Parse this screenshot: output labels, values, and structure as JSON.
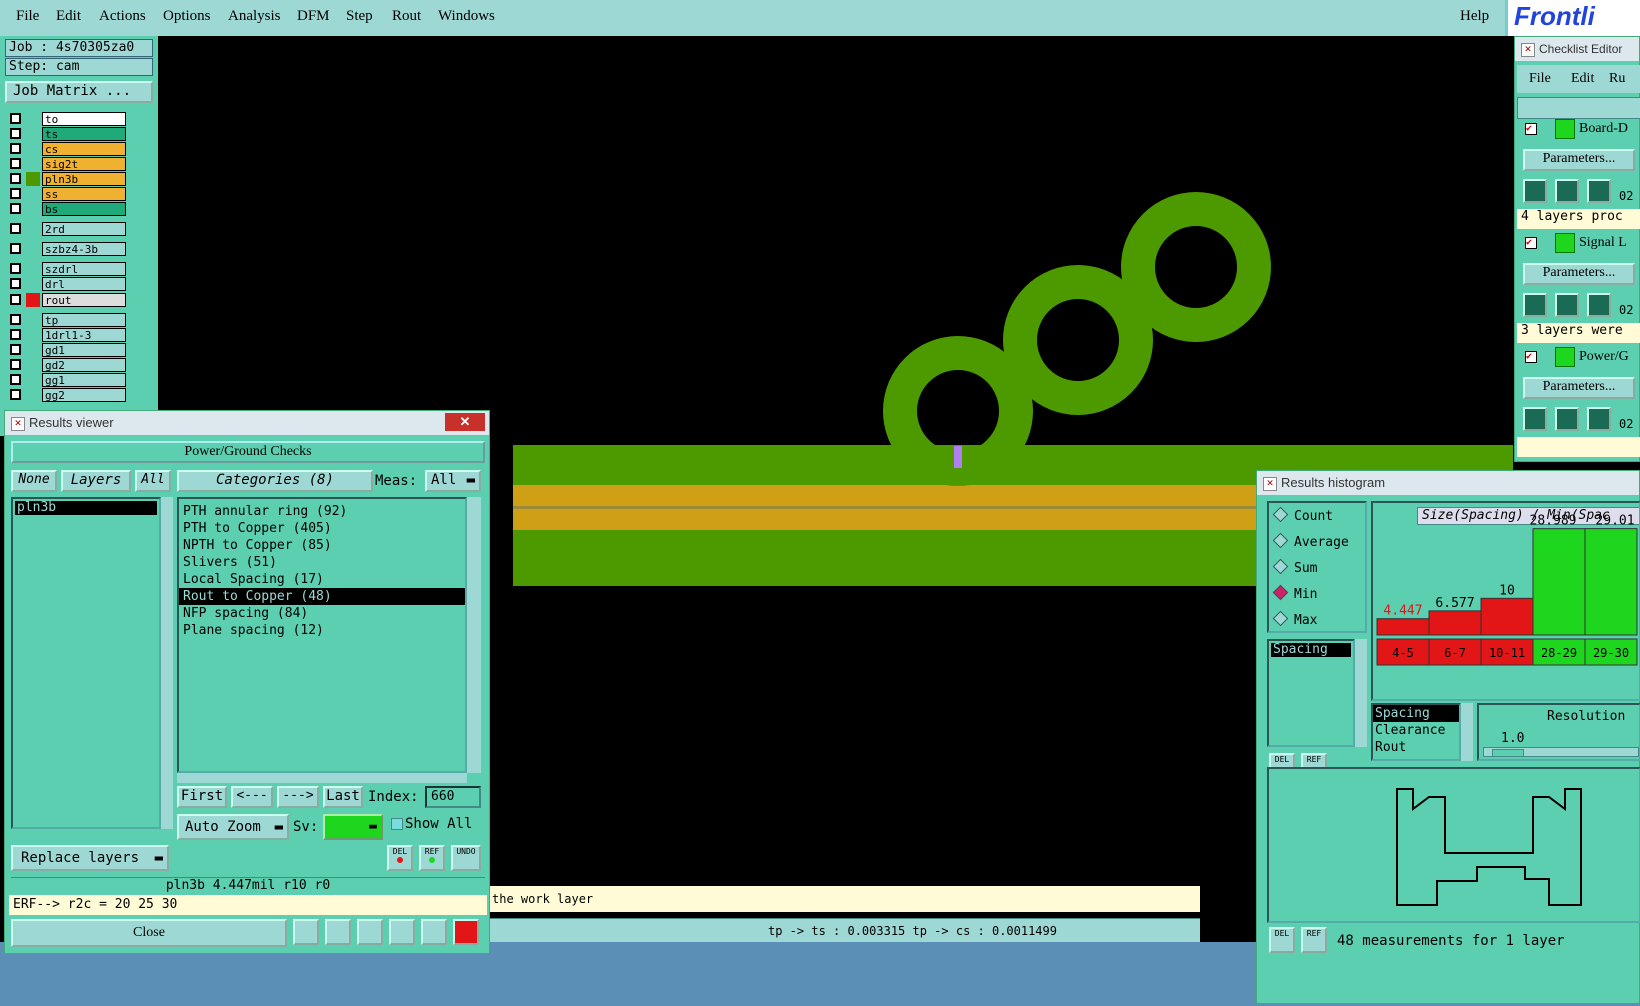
{
  "menu": [
    "File",
    "Edit",
    "Actions",
    "Options",
    "Analysis",
    "DFM",
    "Step",
    "Rout",
    "Windows"
  ],
  "help": "Help",
  "logo": "Frontli",
  "job": {
    "job_line": "Job : 4s70305za0",
    "step_line": "Step: cam",
    "matrix_button": "Job Matrix ..."
  },
  "layers": [
    "to",
    "ts",
    "cs",
    "sig2t",
    "pln3b",
    "ss",
    "bs",
    "2rd",
    "szbz4-3b",
    "szdrl",
    "drl",
    "rout",
    "tp",
    "1drl1-3",
    "gd1",
    "gd2",
    "gg1",
    "gg2"
  ],
  "colors": {
    "copper_green": "#4d9a00",
    "drill_orange": "#cfa015",
    "panel_teal": "#5ccfb0",
    "hist_red": "#e21616",
    "hist_green": "#1fd61f"
  },
  "results_viewer": {
    "title": "Results viewer",
    "group": "Power/Ground Checks",
    "none": "None",
    "layers": "Layers",
    "all": "All",
    "categories_header": "Categories (8)",
    "meas_label": "Meas:",
    "meas_value": "All",
    "layer_list": [
      "pln3b"
    ],
    "categories": [
      "PTH annular ring (92)",
      "PTH to Copper (405)",
      "NPTH to Copper (85)",
      "Slivers (51)",
      "Local Spacing (17)",
      "Rout to Copper (48)",
      "NFP spacing (84)",
      "Plane spacing (12)"
    ],
    "first": "First",
    "prev": "<---",
    "next": "--->",
    "last": "Last",
    "index_label": "Index:",
    "index_value": "660",
    "auto_zoom": "Auto Zoom",
    "sv_label": "Sv:",
    "show_all": "Show All",
    "replace_layers": "Replace layers",
    "del": "DEL",
    "ref": "REF",
    "undo": "UNDO",
    "status": "pln3b 4.447mil  r10  r0",
    "erf": "ERF--> r2c = 20 25 30",
    "close": "Close"
  },
  "status_bar": {
    "message": "the work layer",
    "measure": "tp -> ts : 0.003315    tp -> cs : 0.0011499"
  },
  "checklist": {
    "title": "Checklist Editor",
    "menu": [
      "File",
      "Edit",
      "Ru"
    ],
    "items": [
      {
        "name": "Board-D",
        "params": "Parameters...",
        "note": "4 layers proc",
        "num": "02"
      },
      {
        "name": "Signal L",
        "params": "Parameters...",
        "note": "3 layers were",
        "num": "02"
      },
      {
        "name": "Power/G",
        "params": "Parameters...",
        "note": "",
        "num": "02"
      }
    ]
  },
  "histogram": {
    "title": "Results histogram",
    "modes": [
      "Count",
      "Average",
      "Sum",
      "Min",
      "Max"
    ],
    "selected_mode": "Min",
    "header": "Size(Spacing) / Min(Spac",
    "left_list": [
      "Spacing"
    ],
    "bottom_list": [
      "Spacing",
      "Clearance",
      "Rout"
    ],
    "resolution_label": "Resolution",
    "resolution_value": "1.0",
    "footer": "48 measurements for 1 layer",
    "del": "DEL",
    "ref": "REF"
  },
  "chart_data": {
    "type": "bar",
    "categories": [
      "4-5",
      "6-7",
      "10-11",
      "28-29",
      "29-30"
    ],
    "values": [
      4.447,
      6.577,
      10,
      28.989,
      29.01
    ],
    "value_labels": [
      "4.447",
      "6.577",
      "10",
      "28.989",
      "29.01"
    ],
    "bar_colors": [
      "red",
      "red",
      "red",
      "green",
      "green"
    ],
    "title": "Size(Spacing) / Min(Spac"
  }
}
